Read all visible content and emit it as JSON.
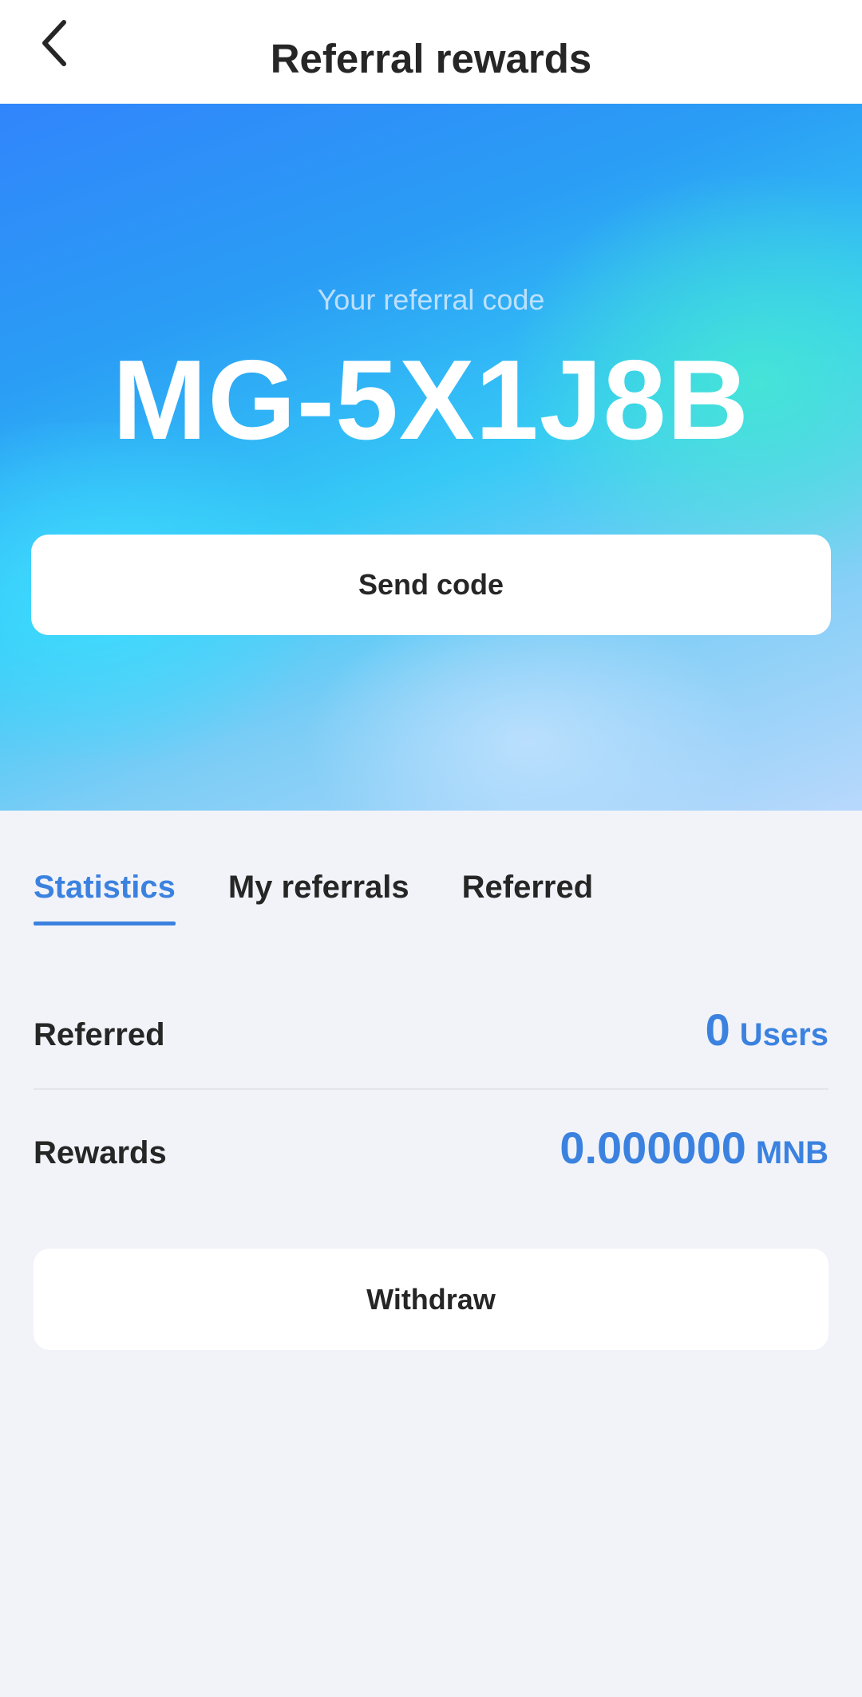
{
  "header": {
    "back_icon": "chevron-left-icon",
    "title": "Referral rewards"
  },
  "hero": {
    "caption": "Your referral code",
    "code": "MG-5X1J8B",
    "send_button_label": "Send code",
    "gradient_colors": [
      "#3185fb",
      "#36c9f6",
      "#46e8d2",
      "#b8d8fc"
    ]
  },
  "tabs": [
    {
      "label": "Statistics",
      "active": true
    },
    {
      "label": "My referrals",
      "active": false
    },
    {
      "label": "Referred",
      "active": false
    }
  ],
  "stats": {
    "referred": {
      "label": "Referred",
      "value": "0",
      "unit": "Users"
    },
    "rewards": {
      "label": "Rewards",
      "value": "0.000000",
      "unit": "MNB"
    }
  },
  "withdraw_button_label": "Withdraw",
  "colors": {
    "accent": "#3b82e0",
    "text": "#262626",
    "background": "#f2f3f8"
  }
}
